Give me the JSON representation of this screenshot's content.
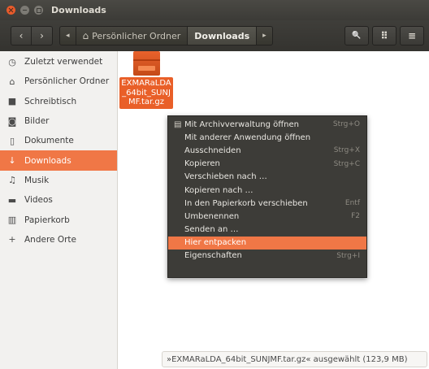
{
  "window": {
    "title": "Downloads"
  },
  "toolbar": {
    "back_glyph": "‹",
    "forward_glyph": "›",
    "crumb_left_glyph": "◂",
    "home_glyph": "⌂",
    "home_label": "Persönlicher Ordner",
    "current_label": "Downloads",
    "crumb_right_glyph": "▸",
    "search_glyph": "🔍",
    "view_glyph": "⠿",
    "menu_glyph": "≡"
  },
  "sidebar": {
    "items": [
      {
        "label": "Zuletzt verwendet",
        "icon": "clock-icon",
        "glyph": "◷"
      },
      {
        "label": "Persönlicher Ordner",
        "icon": "home-icon",
        "glyph": "⌂"
      },
      {
        "label": "Schreibtisch",
        "icon": "folder-icon",
        "glyph": "■"
      },
      {
        "label": "Bilder",
        "icon": "camera-icon",
        "glyph": "◙"
      },
      {
        "label": "Dokumente",
        "icon": "document-icon",
        "glyph": "▯"
      },
      {
        "label": "Downloads",
        "icon": "download-icon",
        "glyph": "↓"
      },
      {
        "label": "Musik",
        "icon": "music-icon",
        "glyph": "♫"
      },
      {
        "label": "Videos",
        "icon": "video-icon",
        "glyph": "▬"
      },
      {
        "label": "Papierkorb",
        "icon": "trash-icon",
        "glyph": "▥"
      },
      {
        "label": "Andere Orte",
        "icon": "plus-icon",
        "glyph": "+"
      }
    ]
  },
  "file": {
    "name": "EXMARaLDA_64bit_SUNJMF.tar.gz"
  },
  "context_menu": {
    "items": [
      {
        "label": "Mit Archivverwaltung öffnen",
        "accel": "Strg+O",
        "glyph": "▤"
      },
      {
        "label": "Mit anderer Anwendung öffnen",
        "accel": ""
      },
      {
        "label": "Ausschneiden",
        "accel": "Strg+X"
      },
      {
        "label": "Kopieren",
        "accel": "Strg+C"
      },
      {
        "label": "Verschieben nach …",
        "accel": ""
      },
      {
        "label": "Kopieren nach …",
        "accel": ""
      },
      {
        "label": "In den Papierkorb verschieben",
        "accel": "Entf"
      },
      {
        "label": "Umbenennen",
        "accel": "F2"
      },
      {
        "label": "Senden an …",
        "accel": ""
      },
      {
        "label": "Hier entpacken",
        "accel": ""
      },
      {
        "label": "Eigenschaften",
        "accel": "Strg+I"
      }
    ]
  },
  "status": {
    "text": "»EXMARaLDA_64bit_SUNJMF.tar.gz« ausgewählt (123,9 MB)"
  },
  "colors": {
    "accent": "#f07746",
    "titlebar": "#3c3b37",
    "menu_bg": "#3d3c38"
  }
}
